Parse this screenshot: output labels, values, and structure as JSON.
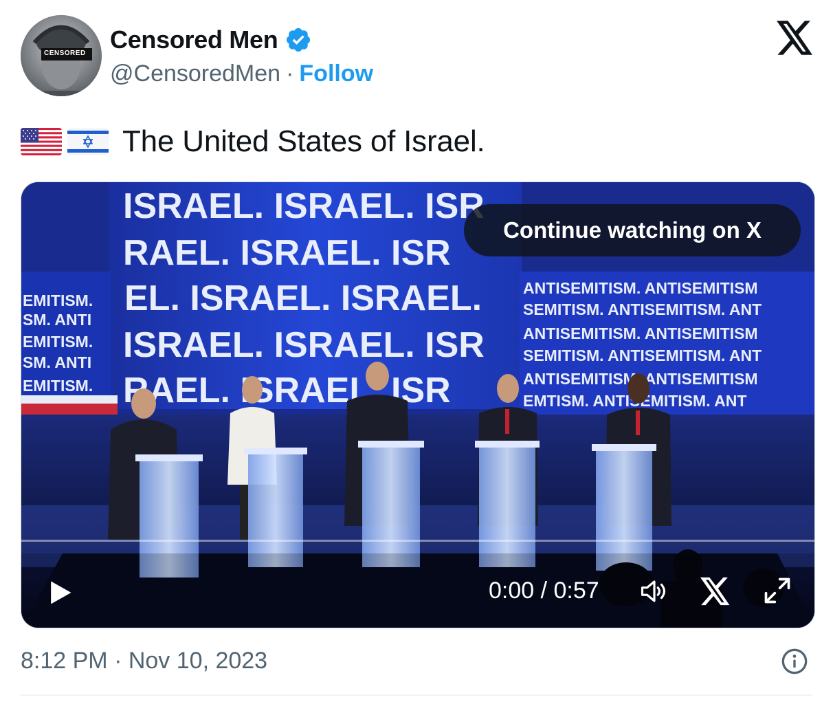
{
  "author": {
    "display_name": "Censored Men",
    "handle": "@CensoredMen",
    "separator": "·",
    "follow_label": "Follow",
    "avatar_badge": "CENSORED",
    "verified_icon": "verified-badge-icon"
  },
  "tweet": {
    "text": "The United States of Israel.",
    "flags": [
      "us-flag-emoji",
      "israel-flag-emoji"
    ]
  },
  "video": {
    "continue_label": "Continue watching on X",
    "time_display": "0:00 / 0:57",
    "progress": 0,
    "controls": [
      "play-icon",
      "volume-icon",
      "x-logo-icon",
      "fullscreen-icon"
    ],
    "screen_text": {
      "israel_lines": [
        "ISRAEL. ISRAEL. ISR",
        "RAEL. ISRAEL. ISR",
        "EL. ISRAEL. ISRAEL.",
        "ISRAEL. ISRAEL. ISR",
        "RAEL. ISRAEL. ISR"
      ],
      "antisemitism_lines": [
        "ANTISEMITISM. ANTISEMITISM",
        "SEMITISM. ANTISEMITISM. ANT",
        "ANTISEMITISM. ANTISEMITISM",
        "SEMITISM. ANTISEMITISM. ANT",
        "ANTISEMITISM. ANTISEMITISM",
        "EMTISM. ANTISEMITISM. ANT"
      ],
      "left_lines": [
        "EMITISM.",
        "SM. ANTI",
        "EMITISM.",
        "SM. ANTI",
        "EMITISM."
      ]
    }
  },
  "timestamp": "8:12 PM · Nov 10, 2023",
  "colors": {
    "link": "#1d9bf0",
    "secondary_text": "#536471",
    "primary_text": "#0f1419",
    "screen_blue": "#1f3fc8"
  }
}
